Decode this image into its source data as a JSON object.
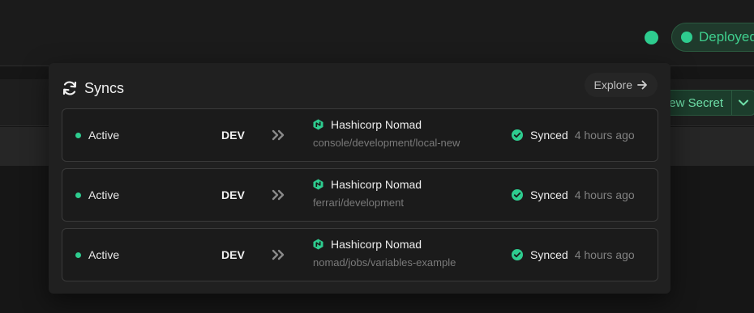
{
  "header": {
    "deploy_label": "Deployed"
  },
  "toolbar": {
    "new_secret_label": "New Secret"
  },
  "popover": {
    "title": "Syncs",
    "explore_label": "Explore",
    "colors": {
      "accent": "#2ecc8f",
      "nomad": "#2ecc8f"
    },
    "syncs": [
      {
        "status": "Active",
        "env": "DEV",
        "destination": "Hashicorp Nomad",
        "path": "console/development/local-new",
        "state": "Synced",
        "time": "4 hours ago"
      },
      {
        "status": "Active",
        "env": "DEV",
        "destination": "Hashicorp Nomad",
        "path": "ferrari/development",
        "state": "Synced",
        "time": "4 hours ago"
      },
      {
        "status": "Active",
        "env": "DEV",
        "destination": "Hashicorp Nomad",
        "path": "nomad/jobs/variables-example",
        "state": "Synced",
        "time": "4 hours ago"
      }
    ]
  }
}
